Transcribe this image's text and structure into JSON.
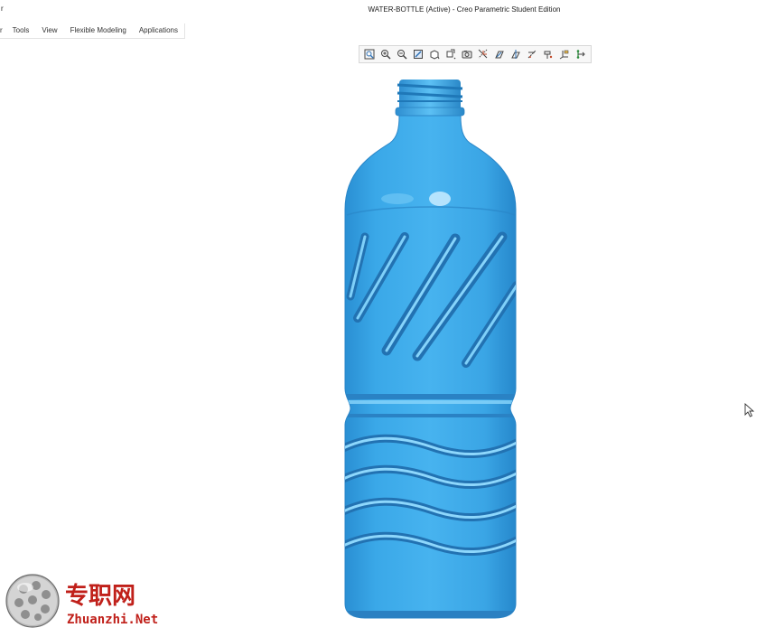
{
  "window": {
    "title": "WATER-BOTTLE (Active) - Creo Parametric Student Edition",
    "left_fragment": "r"
  },
  "menubar": {
    "items": [
      {
        "label": "r"
      },
      {
        "label": "Tools"
      },
      {
        "label": "View"
      },
      {
        "label": "Flexible Modeling"
      },
      {
        "label": "Applications"
      }
    ]
  },
  "toolbar": {
    "buttons": [
      {
        "icon": "refit-icon"
      },
      {
        "icon": "zoom-in-icon"
      },
      {
        "icon": "zoom-out-icon"
      },
      {
        "icon": "repaint-icon"
      },
      {
        "icon": "display-style-icon"
      },
      {
        "icon": "saved-orientations-icon"
      },
      {
        "icon": "view-manager-icon"
      },
      {
        "icon": "perspective-view-icon"
      },
      {
        "icon": "datum-display-icon"
      },
      {
        "icon": "plane-display-icon"
      },
      {
        "icon": "axis-display-icon"
      },
      {
        "icon": "point-display-icon"
      },
      {
        "icon": "csys-display-icon"
      },
      {
        "icon": "annotation-display-icon"
      }
    ]
  },
  "model": {
    "name": "WATER-BOTTLE",
    "color": "#3aa8e6"
  },
  "watermark": {
    "chinese": "专职网",
    "url": "Zhuanzhi.Net",
    "color": "#c0201a"
  }
}
